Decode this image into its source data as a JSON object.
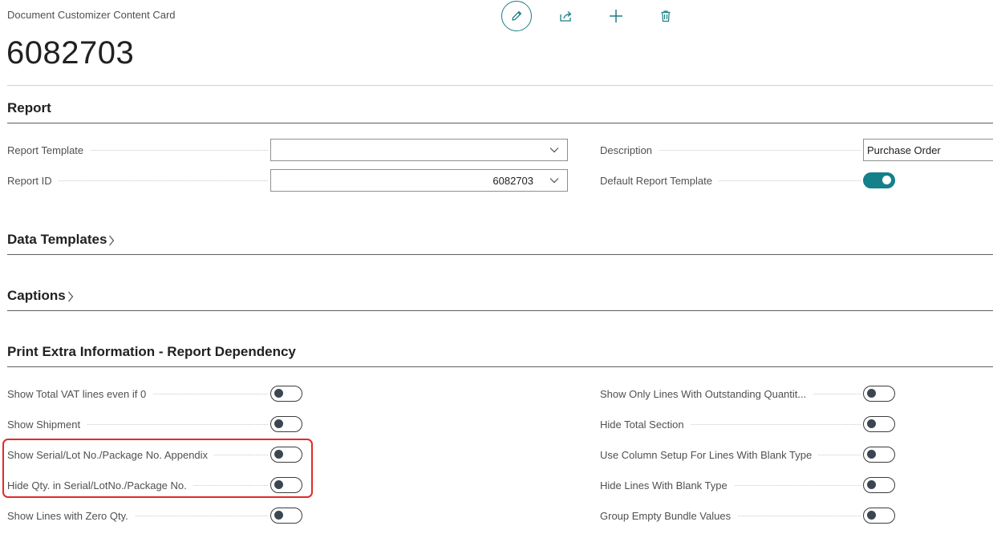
{
  "header": {
    "card_label": "Document Customizer Content Card",
    "record_title": "6082703",
    "actions": [
      {
        "name": "edit",
        "icon": "pencil-icon"
      },
      {
        "name": "share",
        "icon": "share-icon"
      },
      {
        "name": "new",
        "icon": "plus-icon"
      },
      {
        "name": "delete",
        "icon": "trash-icon"
      }
    ]
  },
  "report": {
    "title": "Report",
    "report_template_label": "Report Template",
    "report_template_value": "",
    "report_id_label": "Report ID",
    "report_id_value": "6082703",
    "description_label": "Description",
    "description_value": "Purchase Order",
    "default_template_label": "Default Report Template",
    "default_template_on": true
  },
  "data_templates": {
    "title": "Data Templates"
  },
  "captions": {
    "title": "Captions"
  },
  "print_extra": {
    "title": "Print Extra Information - Report Dependency",
    "left": [
      {
        "label": "Show Total VAT lines even if 0",
        "on": false
      },
      {
        "label": "Show Shipment",
        "on": false
      },
      {
        "label": "Show Serial/Lot No./Package No. Appendix",
        "on": false
      },
      {
        "label": "Hide Qty. in Serial/LotNo./Package No.",
        "on": false
      },
      {
        "label": "Show Lines with Zero Qty.",
        "on": false
      }
    ],
    "right": [
      {
        "label": "Show Only Lines With Outstanding Quantit...",
        "on": false
      },
      {
        "label": "Hide Total Section",
        "on": false
      },
      {
        "label": "Use Column Setup For Lines With Blank Type",
        "on": false
      },
      {
        "label": "Hide Lines With Blank Type",
        "on": false
      },
      {
        "label": "Group Empty Bundle Values",
        "on": false
      }
    ]
  },
  "colors": {
    "accent": "#13808a",
    "highlight": "#e32a2a"
  }
}
